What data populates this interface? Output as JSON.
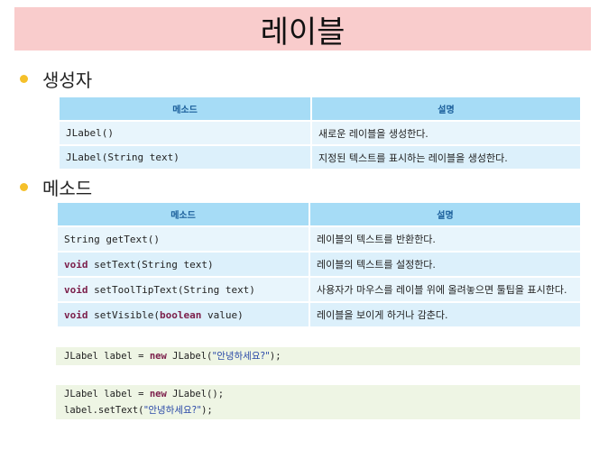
{
  "title": "레이블",
  "sections": [
    {
      "bullet": "생성자"
    },
    {
      "bullet": "메소드"
    }
  ],
  "constructors_table": {
    "headers": [
      "메소드",
      "설명"
    ],
    "rows": [
      {
        "method": "JLabel()",
        "desc": "새로운 레이블을 생성한다."
      },
      {
        "method": "JLabel(String text)",
        "desc": "지정된 텍스트를 표시하는 레이블을 생성한다."
      }
    ]
  },
  "methods_table": {
    "headers": [
      "메소드",
      "설명"
    ],
    "rows": [
      {
        "kw": "",
        "method": "String getText()",
        "desc": "레이블의 텍스트를 반환한다."
      },
      {
        "kw": "void",
        "method": " setText(String text)",
        "desc": "레이블의 텍스트를 설정한다."
      },
      {
        "kw": "void",
        "method": " setToolTipText(String text)",
        "desc": "사용자가 마우스를 레이블 위에 올려놓으면 툴팁을 표시한다."
      },
      {
        "kw": "void",
        "method": " setVisible(",
        "kw2": "boolean",
        "method2": " value)",
        "desc": "레이블을 보이게 하거나 감춘다."
      }
    ]
  },
  "code1": {
    "l1_a": "JLabel label = ",
    "l1_kw": "new",
    "l1_b": " JLabel(",
    "l1_str": "\"안녕하세요?\"",
    "l1_c": ");"
  },
  "code2": {
    "l1_a": "JLabel label = ",
    "l1_kw": "new",
    "l1_b": " JLabel();",
    "l2_a": "label.setText(",
    "l2_str": "\"안녕하세요?\"",
    "l2_b": ");"
  }
}
